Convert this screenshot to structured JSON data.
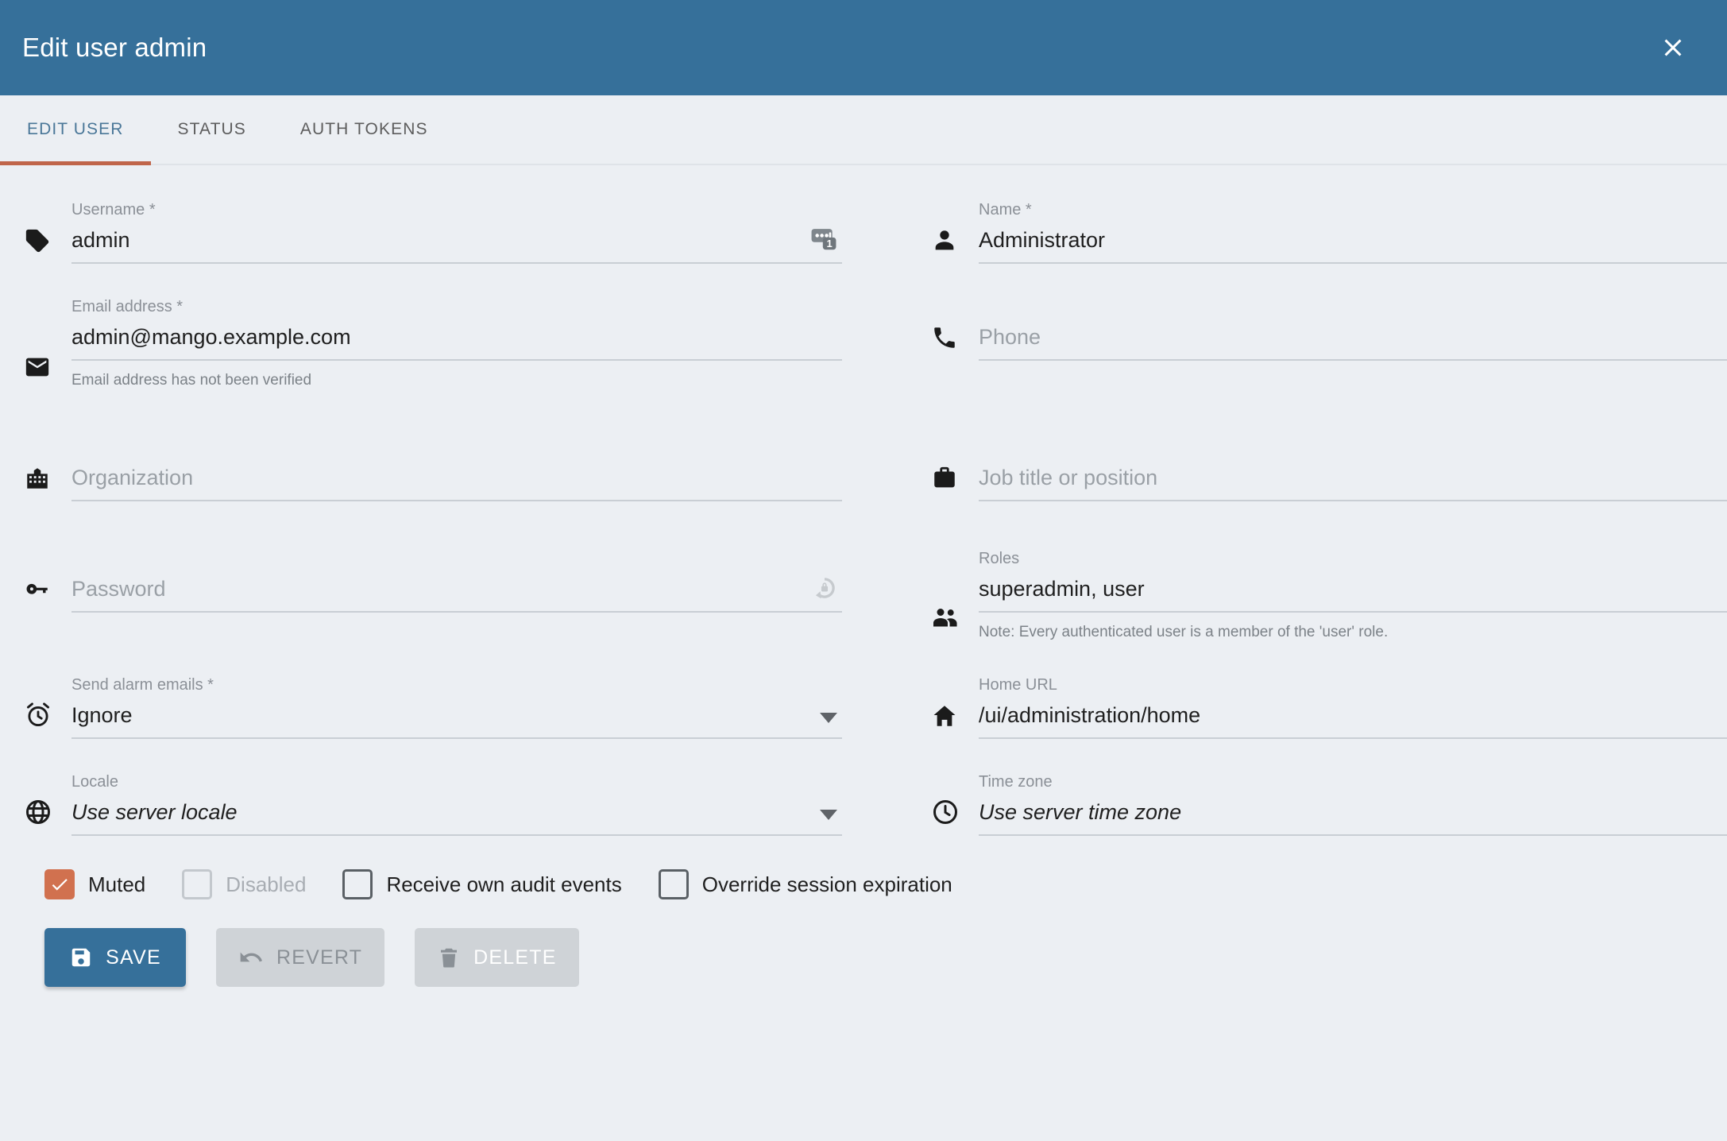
{
  "header": {
    "title": "Edit user admin",
    "close_icon": "close-icon",
    "background_color": "#36709a"
  },
  "tabs": [
    {
      "label": "EDIT USER",
      "active": true
    },
    {
      "label": "STATUS",
      "active": false
    },
    {
      "label": "AUTH TOKENS",
      "active": false
    }
  ],
  "tab_indicator_color": "#c0654a",
  "fields": {
    "username": {
      "label": "Username *",
      "value": "admin",
      "icon": "tag-icon",
      "suffix_icon": "password-manager-badge-icon",
      "suffix_badge": "1"
    },
    "name": {
      "label": "Name *",
      "value": "Administrator",
      "icon": "person-icon"
    },
    "email": {
      "label": "Email address *",
      "value": "admin@mango.example.com",
      "icon": "envelope-icon",
      "hint": "Email address has not been verified"
    },
    "phone": {
      "label": "",
      "placeholder": "Phone",
      "value": "",
      "icon": "phone-icon"
    },
    "organization": {
      "label": "",
      "placeholder": "Organization",
      "value": "",
      "icon": "building-icon"
    },
    "job_title": {
      "label": "",
      "placeholder": "Job title or position",
      "value": "",
      "icon": "briefcase-icon"
    },
    "password": {
      "label": "",
      "placeholder": "Password",
      "value": "",
      "icon": "key-icon",
      "suffix_icon": "regenerate-password-icon"
    },
    "roles": {
      "label": "Roles",
      "value": "superadmin, user",
      "icon": "people-icon",
      "hint": "Note: Every authenticated user is a member of the 'user' role.",
      "options": [
        "superadmin",
        "user"
      ]
    },
    "send_alarm_emails": {
      "label": "Send alarm emails *",
      "value": "Ignore",
      "icon": "alarm-clock-icon",
      "options": [
        "Ignore"
      ]
    },
    "home_url": {
      "label": "Home URL",
      "value": "/ui/administration/home",
      "icon": "home-icon"
    },
    "locale": {
      "label": "Locale",
      "value": "Use server locale",
      "icon": "globe-icon",
      "italic": true,
      "options": [
        "Use server locale"
      ]
    },
    "timezone": {
      "label": "Time zone",
      "value": "Use server time zone",
      "icon": "clock-icon",
      "italic": true,
      "options": [
        "Use server time zone"
      ]
    }
  },
  "checkboxes": [
    {
      "label": "Muted",
      "checked": true,
      "disabled": false
    },
    {
      "label": "Disabled",
      "checked": false,
      "disabled": true
    },
    {
      "label": "Receive own audit events",
      "checked": false,
      "disabled": false
    },
    {
      "label": "Override session expiration",
      "checked": false,
      "disabled": false
    }
  ],
  "buttons": {
    "save": {
      "label": "SAVE",
      "icon": "save-floppy-icon",
      "disabled": false
    },
    "revert": {
      "label": "REVERT",
      "icon": "undo-arrow-icon",
      "disabled": true
    },
    "delete": {
      "label": "DELETE",
      "icon": "trash-icon",
      "disabled": true
    }
  },
  "colors": {
    "accent_blue": "#36709a",
    "accent_orange": "#c0654a",
    "background": "#eceff3",
    "checkbox_checked": "#d1714f"
  }
}
